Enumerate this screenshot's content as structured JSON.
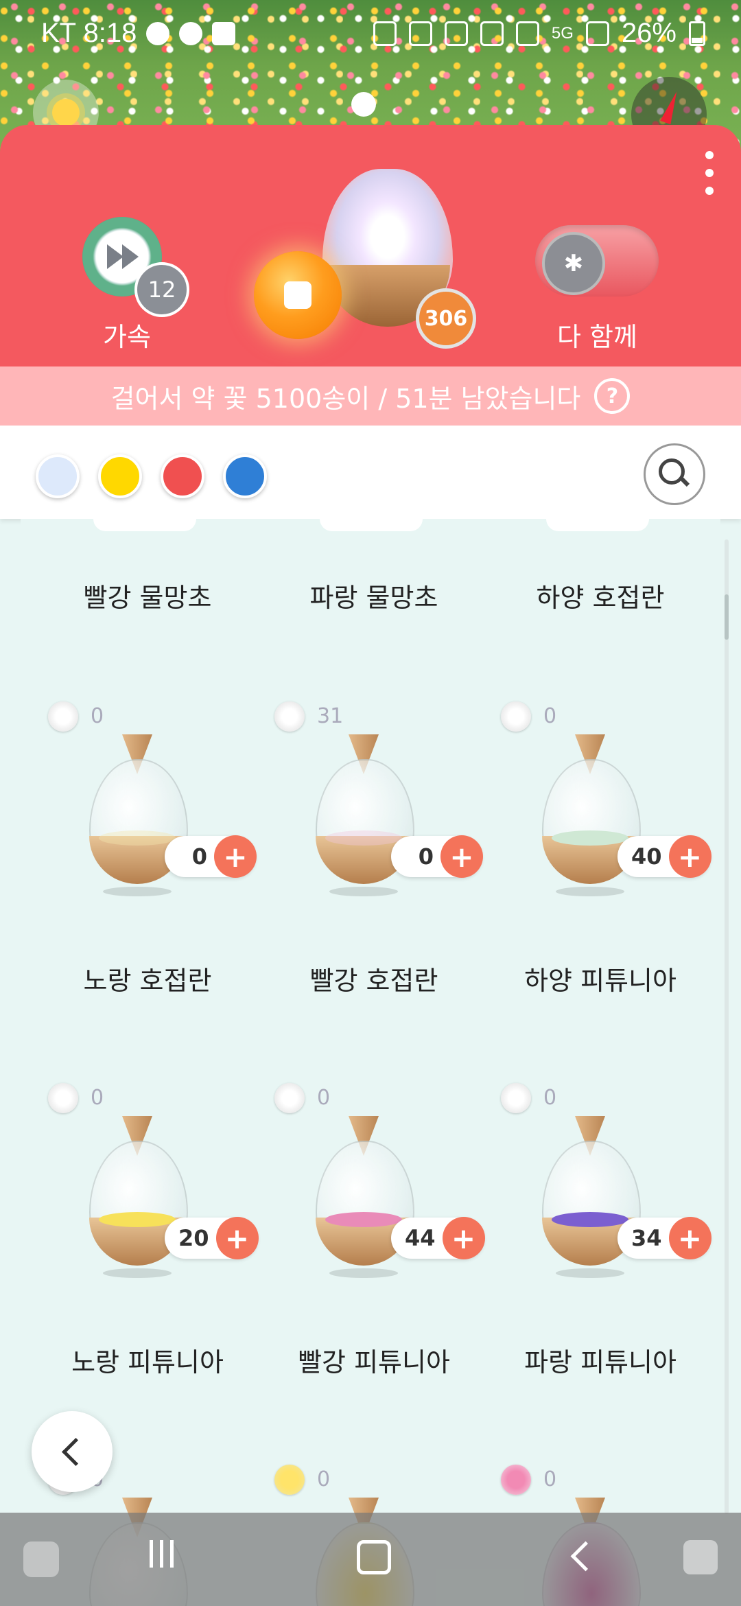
{
  "status_bar": {
    "carrier_time": "KT 8:18",
    "battery_pct": "26%",
    "network": "5G"
  },
  "header": {
    "speed_label": "가속",
    "speed_count": "12",
    "terrarium_count": "306",
    "together_label": "다 함께",
    "menu_icon": "more-vertical-icon"
  },
  "notice": {
    "text": "걸어서 약 꽃 5100송이 / 51분 남았습니다",
    "help_glyph": "?"
  },
  "filters": {
    "colors": [
      "#dde9fb",
      "#ffd800",
      "#f05050",
      "#2f7fd6"
    ]
  },
  "grid": {
    "partial_row": [
      "빨강 물망초",
      "파랑 물망초",
      "하양 호접란"
    ],
    "items": [
      {
        "name": "노랑 호접란",
        "seeds": "0",
        "qty": "0",
        "petal": "#f3e7b0"
      },
      {
        "name": "빨강 호접란",
        "seeds": "31",
        "qty": "0",
        "petal": "#f0c9de"
      },
      {
        "name": "하양 피튜니아",
        "seeds": "0",
        "qty": "40",
        "petal": "#e8f3ea"
      },
      {
        "name": "노랑 피튜니아",
        "seeds": "0",
        "qty": "20",
        "petal": "#f7e15a"
      },
      {
        "name": "빨강 피튜니아",
        "seeds": "0",
        "qty": "44",
        "petal": "#e98bb8"
      },
      {
        "name": "파랑 피튜니아",
        "seeds": "0",
        "qty": "34",
        "petal": "#7b5fd0"
      }
    ],
    "next_row_seeds": [
      "0",
      "0",
      "0"
    ]
  }
}
